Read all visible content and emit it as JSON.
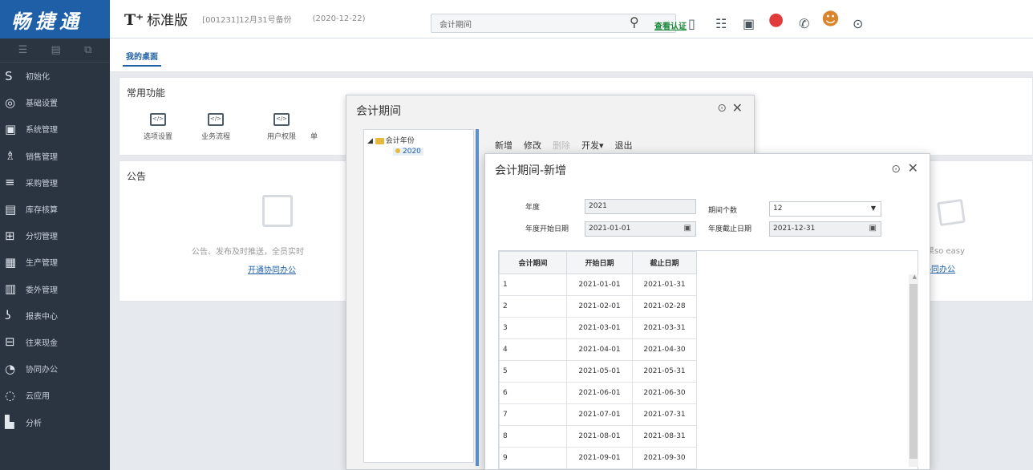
{
  "sidebar": {
    "logo": "畅捷通",
    "tools": [
      "☰",
      "▤",
      "⧉"
    ],
    "items": [
      {
        "label": "初始化",
        "icon": "S"
      },
      {
        "label": "基础设置",
        "icon": "◎"
      },
      {
        "label": "系统管理",
        "icon": "▣"
      },
      {
        "label": "销售管理",
        "icon": "♗"
      },
      {
        "label": "采购管理",
        "icon": "≡"
      },
      {
        "label": "库存核算",
        "icon": "▤"
      },
      {
        "label": "分切管理",
        "icon": "⊞"
      },
      {
        "label": "生产管理",
        "icon": "▦"
      },
      {
        "label": "委外管理",
        "icon": "▥"
      },
      {
        "label": "报表中心",
        "icon": "ʖ"
      },
      {
        "label": "往来现金",
        "icon": "⊟"
      },
      {
        "label": "协同办公",
        "icon": "◔"
      },
      {
        "label": "云应用",
        "icon": "◌"
      },
      {
        "label": "分析",
        "icon": "▙"
      }
    ]
  },
  "header": {
    "brand": "T⁺",
    "brand_sub": "标准版",
    "account": "[001231]12月31号备份",
    "date": "(2020-12-22)",
    "search_value": "会计期间",
    "verify_link": "查看认证"
  },
  "tabs": {
    "active": "我的桌面"
  },
  "common": {
    "title": "常用功能",
    "items": [
      "选项设置",
      "业务流程",
      "用户权限",
      "单"
    ]
  },
  "notice": {
    "title": "公告",
    "empty_text": "公告、发布及时推送，全员实时",
    "link": "开通协同办公",
    "right_text": "，跟踪结果so easy",
    "right_link": "协同办公"
  },
  "dialog_period": {
    "title": "会计期间",
    "tree_root": "会计年份",
    "tree_child": "2020",
    "toolbar": [
      "新增",
      "修改",
      "删除",
      "开发▾",
      "退出"
    ]
  },
  "dialog_new": {
    "title": "会计期间-新增",
    "year_label": "年度",
    "year_value": "2021",
    "periods_label": "期间个数",
    "periods_value": "12",
    "start_label": "年度开始日期",
    "start_value": "2021-01-01",
    "end_label": "年度截止日期",
    "end_value": "2021-12-31",
    "columns": [
      "会计期间",
      "开始日期",
      "截止日期"
    ],
    "rows": [
      [
        "1",
        "2021-01-01",
        "2021-01-31"
      ],
      [
        "2",
        "2021-02-01",
        "2021-02-28"
      ],
      [
        "3",
        "2021-03-01",
        "2021-03-31"
      ],
      [
        "4",
        "2021-04-01",
        "2021-04-30"
      ],
      [
        "5",
        "2021-05-01",
        "2021-05-31"
      ],
      [
        "6",
        "2021-06-01",
        "2021-06-30"
      ],
      [
        "7",
        "2021-07-01",
        "2021-07-31"
      ],
      [
        "8",
        "2021-08-01",
        "2021-08-31"
      ],
      [
        "9",
        "2021-09-01",
        "2021-09-30"
      ]
    ]
  }
}
